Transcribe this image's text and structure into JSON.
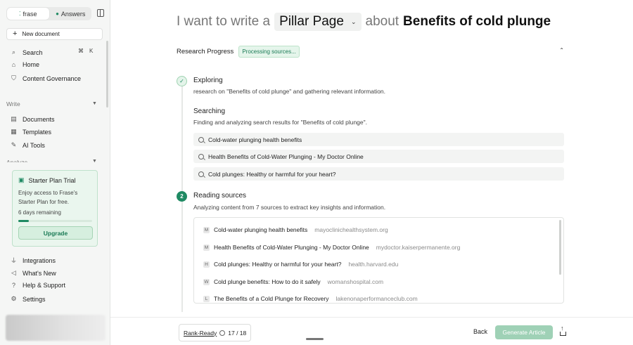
{
  "sidebar": {
    "tabs": [
      {
        "label": "frase",
        "icon": "frase-logo-icon"
      },
      {
        "label": "Answers",
        "icon": "answers-icon"
      }
    ],
    "new_document": "New document",
    "search": {
      "label": "Search",
      "shortcut_mod": "⌘",
      "shortcut_key": "K"
    },
    "home": "Home",
    "content_governance": "Content Governance",
    "write_section": "Write",
    "documents": "Documents",
    "templates": "Templates",
    "ai_tools": "AI Tools",
    "analyze_section": "Analyze",
    "trial": {
      "title": "Starter Plan Trial",
      "text": "Enjoy access to Frase's Starter Plan for free.",
      "days_remaining": "6 days remaining",
      "progress_fraction": 0.14,
      "upgrade": "Upgrade"
    },
    "integrations": "Integrations",
    "whats_new": "What's New",
    "help": "Help & Support",
    "settings": "Settings"
  },
  "headline": {
    "prefix": "I want to write a",
    "content_type": "Pillar Page",
    "middle": "about",
    "topic": "Benefits of cold plunge"
  },
  "research": {
    "title": "Research Progress",
    "status": "Processing sources..."
  },
  "steps": {
    "exploring": {
      "title": "Exploring",
      "desc": "research on \"Benefits of cold plunge\" and gathering relevant information."
    },
    "searching": {
      "title": "Searching",
      "desc": "Finding and analyzing search results for \"Benefits of cold plunge\".",
      "queries": [
        "Cold-water plunging health benefits",
        "Health Benefits of Cold-Water Plunging - My Doctor Online",
        "Cold plunges: Healthy or harmful for your heart?"
      ]
    },
    "reading": {
      "number": "2",
      "title": "Reading sources",
      "desc": "Analyzing content from 7 sources to extract key insights and information.",
      "sources": [
        {
          "favicon": "M",
          "title": "Cold-water plunging health benefits",
          "domain": "mayoclinichealthsystem.org"
        },
        {
          "favicon": "M",
          "title": "Health Benefits of Cold-Water Plunging - My Doctor Online",
          "domain": "mydoctor.kaiserpermanente.org"
        },
        {
          "favicon": "H",
          "title": "Cold plunges: Healthy or harmful for your heart?",
          "domain": "health.harvard.edu"
        },
        {
          "favicon": "W",
          "title": "Cold plunge benefits: How to do it safely",
          "domain": "womanshospital.com"
        },
        {
          "favicon": "L",
          "title": "The Benefits of a Cold Plunge for Recovery",
          "domain": "lakenonaperformanceclub.com"
        }
      ]
    }
  },
  "bottom": {
    "rank_label": "Rank-Ready",
    "rank_count": "17 / 18",
    "back": "Back",
    "generate": "Generate Article"
  }
}
